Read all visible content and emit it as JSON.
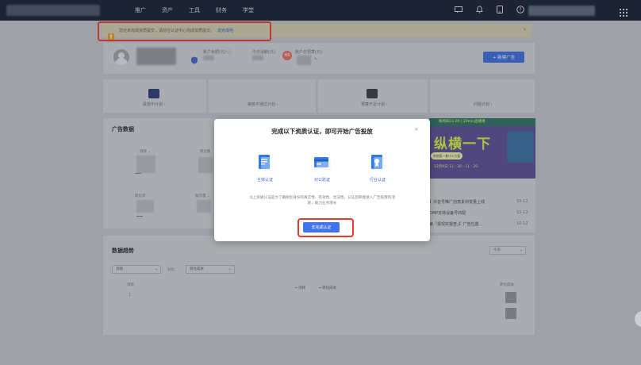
{
  "nav": {
    "items": [
      "推广",
      "资产",
      "工具",
      "财务",
      "学堂"
    ]
  },
  "notice": {
    "text": "您还未完成资质提交，请前往认证中心完成资质提交。",
    "link": "去完成吧"
  },
  "account": {
    "balance_label": "账户余额(元) ⓘ",
    "today_spend_label": "今日消耗(元)",
    "budget_label": "账户日预算(元)",
    "badge": "HX",
    "new_ad_button": "+ 新建广告"
  },
  "plans": [
    {
      "label": "投放中计划 ›"
    },
    {
      "label": "审核不通过计划 ›"
    },
    {
      "label": "预算不足计划 ›"
    },
    {
      "label": "问题计划 ›"
    }
  ],
  "ad_data": {
    "title": "广告数据",
    "metrics": [
      "消耗 ⌄",
      "转化数",
      "转化率",
      "展示量 ⌄"
    ]
  },
  "banner": {
    "top_text": "每周四11:00 | 20min直播课",
    "big_text": "纵横一下",
    "chip": "你想要一套什么方案",
    "sub": "12月9日 11 : 30 - 11 : 20"
  },
  "news": [
    {
      "text": "】抖音号推广创意素材变量上线",
      "date": "10-12"
    },
    {
      "text": "DMP支持设备号匹配",
      "date": "10-12"
    },
    {
      "text": "第「报现实报查」】广告位置...",
      "date": "10-12"
    }
  ],
  "trend": {
    "title": "数据趋势",
    "range_select": "今天",
    "metric1": "消耗",
    "compare_label": "对比",
    "metric2": "转化成本",
    "left_axis": "消耗",
    "left_value": "1",
    "right_axis": "转化成本",
    "legend1": "━ 消耗",
    "legend2": "━ 转化成本"
  },
  "modal": {
    "title": "完成以下资质认证，即可开始广告投放",
    "close": "×",
    "options": [
      {
        "label": "主体认证",
        "icon": "document-icon"
      },
      {
        "label": "对公验证",
        "icon": "card-icon"
      },
      {
        "label": "行业认证",
        "icon": "certificate-icon"
      }
    ],
    "description": "以上资质认证是为了确保您身份的真实性、有效性、合法性，认证后即能进入广告投放和消耗，助力业务增长",
    "button": "去完成认证"
  },
  "colors": {
    "nav_bg": "#1a2233",
    "primary": "#3f74ee",
    "highlight": "#e23c2d"
  }
}
